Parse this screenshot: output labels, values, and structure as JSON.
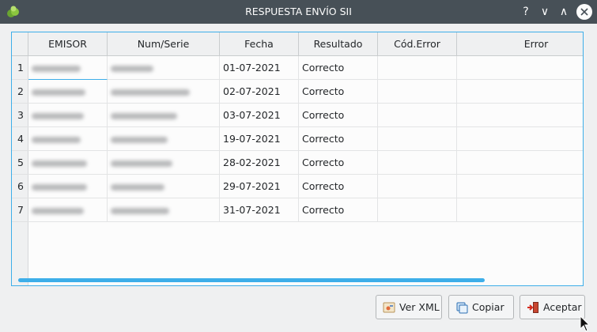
{
  "window": {
    "title": "RESPUESTA ENVÍO SII",
    "help": "?",
    "minimize": "∨",
    "maximize": "∧"
  },
  "table": {
    "columns": [
      "EMISOR",
      "Num/Serie",
      "Fecha",
      "Resultado",
      "Cód.Error",
      "Error"
    ],
    "rows": [
      {
        "num": "1",
        "fecha": "01-07-2021",
        "resultado": "Correcto",
        "cod_error": "",
        "error": ""
      },
      {
        "num": "2",
        "fecha": "02-07-2021",
        "resultado": "Correcto",
        "cod_error": "",
        "error": ""
      },
      {
        "num": "3",
        "fecha": "03-07-2021",
        "resultado": "Correcto",
        "cod_error": "",
        "error": ""
      },
      {
        "num": "4",
        "fecha": "19-07-2021",
        "resultado": "Correcto",
        "cod_error": "",
        "error": ""
      },
      {
        "num": "5",
        "fecha": "28-02-2021",
        "resultado": "Correcto",
        "cod_error": "",
        "error": ""
      },
      {
        "num": "6",
        "fecha": "29-07-2021",
        "resultado": "Correcto",
        "cod_error": "",
        "error": ""
      },
      {
        "num": "7",
        "fecha": "31-07-2021",
        "resultado": "Correcto",
        "cod_error": "",
        "error": ""
      }
    ]
  },
  "buttons": {
    "ver_xml": "Ver XML",
    "copiar": "Copiar",
    "aceptar": "Aceptar"
  },
  "icons": {
    "app": "app-leaf-icon",
    "close": "close-icon",
    "ver_xml": "xml-view-icon",
    "copiar": "copy-icon",
    "aceptar": "exit-door-icon"
  },
  "colors": {
    "titlebar": "#475057",
    "accent": "#3daee9",
    "window_bg": "#eff0f1"
  }
}
